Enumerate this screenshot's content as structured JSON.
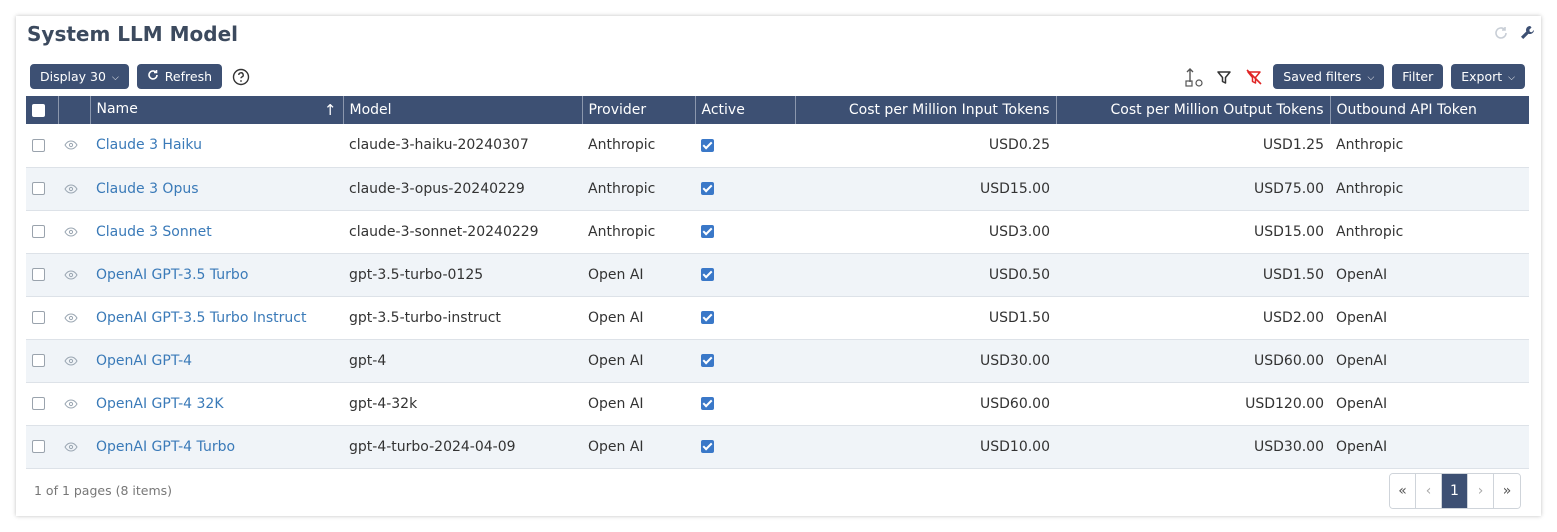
{
  "page": {
    "title": "System LLM Model"
  },
  "toolbar": {
    "display_label": "Display 30",
    "refresh_label": "Refresh",
    "saved_filters_label": "Saved filters",
    "filter_label": "Filter",
    "export_label": "Export"
  },
  "table": {
    "columns": {
      "name": "Name",
      "model": "Model",
      "provider": "Provider",
      "active": "Active",
      "cost_input": "Cost per Million Input Tokens",
      "cost_output": "Cost per Million Output Tokens",
      "token": "Outbound API Token"
    },
    "rows": [
      {
        "name": "Claude 3 Haiku",
        "model": "claude-3-haiku-20240307",
        "provider": "Anthropic",
        "active": true,
        "cost_input": "USD0.25",
        "cost_output": "USD1.25",
        "token": "Anthropic"
      },
      {
        "name": "Claude 3 Opus",
        "model": "claude-3-opus-20240229",
        "provider": "Anthropic",
        "active": true,
        "cost_input": "USD15.00",
        "cost_output": "USD75.00",
        "token": "Anthropic"
      },
      {
        "name": "Claude 3 Sonnet",
        "model": "claude-3-sonnet-20240229",
        "provider": "Anthropic",
        "active": true,
        "cost_input": "USD3.00",
        "cost_output": "USD15.00",
        "token": "Anthropic"
      },
      {
        "name": "OpenAI GPT-3.5 Turbo",
        "model": "gpt-3.5-turbo-0125",
        "provider": "Open AI",
        "active": true,
        "cost_input": "USD0.50",
        "cost_output": "USD1.50",
        "token": "OpenAI"
      },
      {
        "name": "OpenAI GPT-3.5 Turbo Instruct",
        "model": "gpt-3.5-turbo-instruct",
        "provider": "Open AI",
        "active": true,
        "cost_input": "USD1.50",
        "cost_output": "USD2.00",
        "token": "OpenAI"
      },
      {
        "name": "OpenAI GPT-4",
        "model": "gpt-4",
        "provider": "Open AI",
        "active": true,
        "cost_input": "USD30.00",
        "cost_output": "USD60.00",
        "token": "OpenAI"
      },
      {
        "name": "OpenAI GPT-4 32K",
        "model": "gpt-4-32k",
        "provider": "Open AI",
        "active": true,
        "cost_input": "USD60.00",
        "cost_output": "USD120.00",
        "token": "OpenAI"
      },
      {
        "name": "OpenAI GPT-4 Turbo",
        "model": "gpt-4-turbo-2024-04-09",
        "provider": "Open AI",
        "active": true,
        "cost_input": "USD10.00",
        "cost_output": "USD30.00",
        "token": "OpenAI"
      }
    ]
  },
  "footer": {
    "summary": "1 of 1 pages (8 items)",
    "pager": {
      "first": "«",
      "prev": "‹",
      "current": "1",
      "next": "›",
      "last": "»"
    }
  },
  "colors": {
    "header_bg": "#3d5073",
    "link": "#3a7ab8",
    "checkbox": "#3a78c8",
    "filter_clear": "#e02424"
  },
  "icons": {
    "corner": [
      "refresh-icon",
      "wrench-icon"
    ],
    "toolbar": [
      "help-icon",
      "sort-clear-icon",
      "filter-icon",
      "filter-clear-icon"
    ],
    "row": "eye-icon"
  }
}
